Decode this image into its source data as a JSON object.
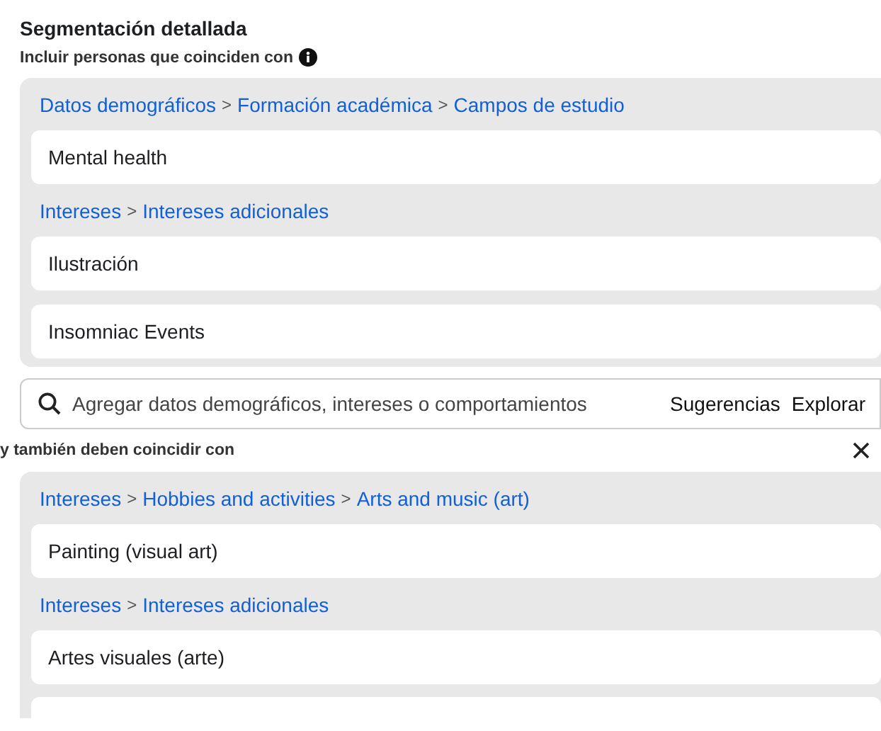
{
  "title": "Segmentación detallada",
  "sections": [
    {
      "label": "Incluir personas que coinciden con",
      "info": true,
      "removable": false,
      "more_below": false,
      "groups": [
        {
          "breadcrumb": [
            {
              "kind": "link",
              "text": "Datos demográficos"
            },
            {
              "kind": "separator",
              "text": ">"
            },
            {
              "kind": "link",
              "text": "Formación académica"
            },
            {
              "kind": "separator",
              "text": ">"
            },
            {
              "kind": "link",
              "text": "Campos de estudio"
            }
          ],
          "items": [
            "Mental health"
          ]
        },
        {
          "breadcrumb": [
            {
              "kind": "link",
              "text": "Intereses"
            },
            {
              "kind": "separator",
              "text": ">"
            },
            {
              "kind": "link",
              "text": "Intereses adicionales"
            }
          ],
          "items": [
            "Ilustración",
            "Insomniac Events"
          ]
        }
      ],
      "search": {
        "placeholder": "Agregar datos demográficos, intereses o comportamientos",
        "actions": [
          "Sugerencias",
          "Explorar"
        ]
      }
    },
    {
      "label": "y también deben coincidir con",
      "info": false,
      "removable": true,
      "more_below": true,
      "groups": [
        {
          "breadcrumb": [
            {
              "kind": "link",
              "text": "Intereses"
            },
            {
              "kind": "separator",
              "text": ">"
            },
            {
              "kind": "link",
              "text": "Hobbies and activities"
            },
            {
              "kind": "separator",
              "text": ">"
            },
            {
              "kind": "link",
              "text": "Arts and music (art)"
            }
          ],
          "items": [
            "Painting (visual art)"
          ]
        },
        {
          "breadcrumb": [
            {
              "kind": "link",
              "text": "Intereses"
            },
            {
              "kind": "separator",
              "text": ">"
            },
            {
              "kind": "link",
              "text": "Intereses adicionales"
            }
          ],
          "items": [
            "Artes visuales (arte)"
          ]
        }
      ]
    }
  ]
}
